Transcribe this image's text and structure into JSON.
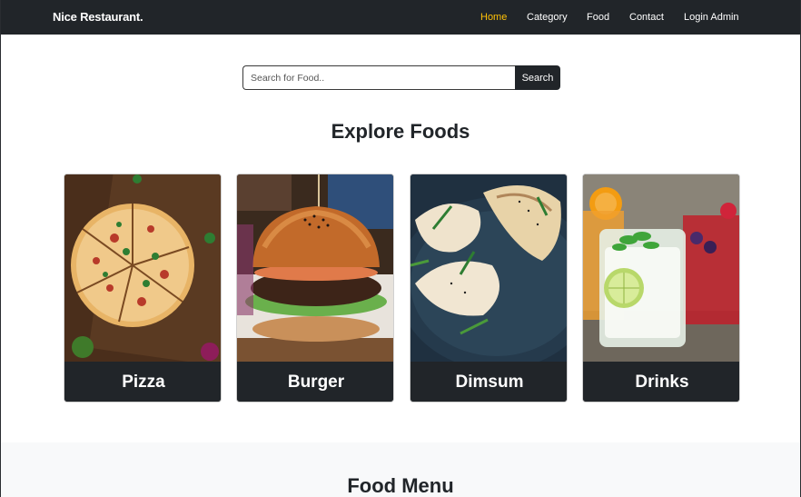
{
  "navbar": {
    "brand": "Nice Restaurant.",
    "links": [
      "Home",
      "Category",
      "Food",
      "Contact",
      "Login Admin"
    ],
    "active_color": "#ffc107"
  },
  "search": {
    "placeholder": "Search for Food..",
    "button_label": "Search"
  },
  "explore": {
    "title": "Explore Foods",
    "categories": [
      "Pizza",
      "Burger",
      "Dimsum",
      "Drinks"
    ]
  },
  "menu": {
    "title": "Food Menu"
  },
  "colors": {
    "dark": "#212529",
    "light_bg": "#f8f9fa",
    "accent": "#ffc107"
  }
}
